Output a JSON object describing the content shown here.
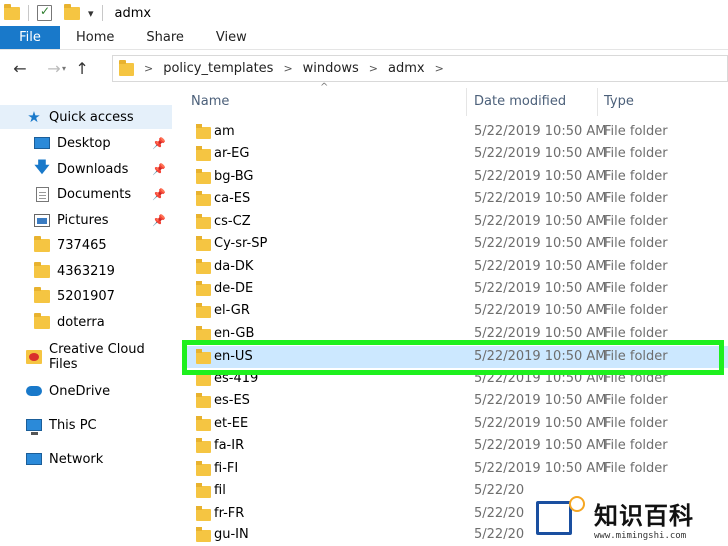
{
  "window": {
    "title": "admx"
  },
  "ribbon": {
    "tabs": [
      "File",
      "Home",
      "Share",
      "View"
    ]
  },
  "nav": {
    "back": "←",
    "forward": "→",
    "up": "↑"
  },
  "address": {
    "crumbs": [
      "policy_templates",
      "windows",
      "admx"
    ]
  },
  "sidebar": {
    "quick_access": "Quick access",
    "pinned": [
      "Desktop",
      "Downloads",
      "Documents",
      "Pictures"
    ],
    "folders": [
      "737465",
      "4363219",
      "5201907",
      "doterra"
    ],
    "creative_cloud": "Creative Cloud Files",
    "onedrive": "OneDrive",
    "this_pc": "This PC",
    "network": "Network"
  },
  "columns": {
    "name": "Name",
    "date": "Date modified",
    "type": "Type"
  },
  "files": [
    {
      "name": "am",
      "date": "5/22/2019 10:50 AM",
      "type": "File folder"
    },
    {
      "name": "ar-EG",
      "date": "5/22/2019 10:50 AM",
      "type": "File folder"
    },
    {
      "name": "bg-BG",
      "date": "5/22/2019 10:50 AM",
      "type": "File folder"
    },
    {
      "name": "ca-ES",
      "date": "5/22/2019 10:50 AM",
      "type": "File folder"
    },
    {
      "name": "cs-CZ",
      "date": "5/22/2019 10:50 AM",
      "type": "File folder"
    },
    {
      "name": "Cy-sr-SP",
      "date": "5/22/2019 10:50 AM",
      "type": "File folder"
    },
    {
      "name": "da-DK",
      "date": "5/22/2019 10:50 AM",
      "type": "File folder"
    },
    {
      "name": "de-DE",
      "date": "5/22/2019 10:50 AM",
      "type": "File folder"
    },
    {
      "name": "el-GR",
      "date": "5/22/2019 10:50 AM",
      "type": "File folder"
    },
    {
      "name": "en-GB",
      "date": "5/22/2019 10:50 AM",
      "type": "File folder"
    },
    {
      "name": "en-US",
      "date": "5/22/2019 10:50 AM",
      "type": "File folder"
    },
    {
      "name": "es-419",
      "date": "5/22/2019 10:50 AM",
      "type": "File folder"
    },
    {
      "name": "es-ES",
      "date": "5/22/2019 10:50 AM",
      "type": "File folder"
    },
    {
      "name": "et-EE",
      "date": "5/22/2019 10:50 AM",
      "type": "File folder"
    },
    {
      "name": "fa-IR",
      "date": "5/22/2019 10:50 AM",
      "type": "File folder"
    },
    {
      "name": "fi-FI",
      "date": "5/22/2019 10:50 AM",
      "type": "File folder"
    },
    {
      "name": "fil",
      "date": "5/22/20",
      "type": ""
    },
    {
      "name": "fr-FR",
      "date": "5/22/20",
      "type": ""
    },
    {
      "name": "gu-IN",
      "date": "5/22/20",
      "type": ""
    }
  ],
  "selected_file": "en-US",
  "watermark": {
    "brand": "知识百科",
    "url": "www.mimingshi.com"
  },
  "colors": {
    "accent": "#1979ca",
    "selection": "#cce8ff",
    "highlight": "#1ef01e"
  }
}
